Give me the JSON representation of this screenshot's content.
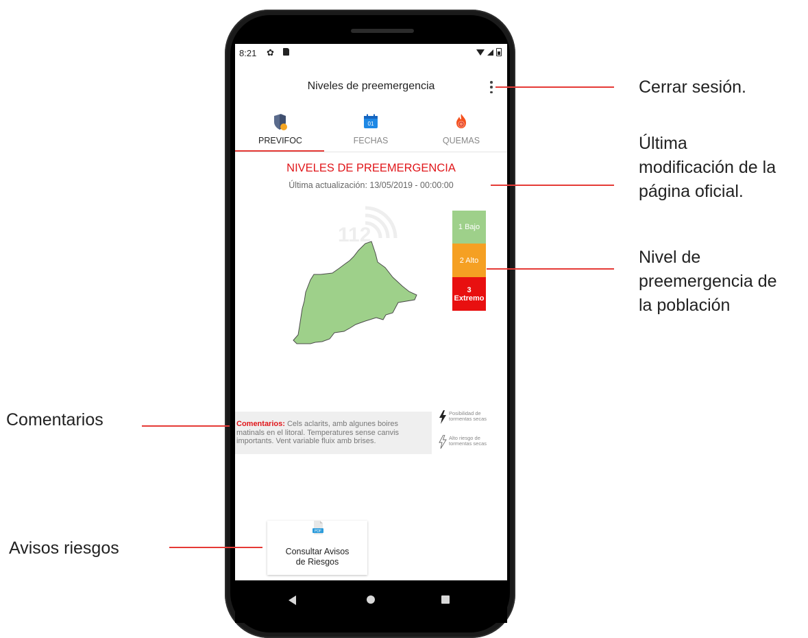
{
  "status_bar": {
    "time": "8:21",
    "gear_glyph": "✿"
  },
  "app_bar": {
    "title": "Niveles de preemergencia"
  },
  "tabs": [
    {
      "label": "PREVIFOC",
      "icon": "shield-icon",
      "color": "#222222"
    },
    {
      "label": "FECHAS",
      "icon": "calendar-icon",
      "calendar_day": "01",
      "color": "#888888"
    },
    {
      "label": "QUEMAS",
      "icon": "fire-icon",
      "color": "#888888"
    }
  ],
  "content": {
    "title": "NIVELES DE PREEMERGENCIA",
    "last_update": "Última actualización: 13/05/2019 - 00:00:00",
    "watermark": "112",
    "levels": [
      {
        "label": "1 Bajo",
        "color": "#9ed08a"
      },
      {
        "label": "2 Alto",
        "color": "#f5a023"
      },
      {
        "label": "3 Extremo",
        "num": "3",
        "name": "Extremo",
        "color": "#e81010"
      }
    ],
    "comments_label": "Comentarios:",
    "comments_text": " Cels aclarits, amb algunes boires matinals en el litoral. Temperatures sense canvis importants. Vent variable fluix amb brises.",
    "legend": [
      {
        "icon": "lightning-filled-icon",
        "text": "Posibilidad de tormentas secas"
      },
      {
        "icon": "lightning-outline-icon",
        "text": "Alto riesgo de tormentas secas"
      }
    ],
    "risk_button": {
      "line1": "Consultar Avisos",
      "line2": "de Riesgos",
      "icon_text": "PDF"
    }
  },
  "annotations": {
    "cerrar": "Cerrar sesión.",
    "ultima_1": "Última",
    "ultima_2": "modificación de la",
    "ultima_3": "página oficial.",
    "nivel_1": "Nivel de",
    "nivel_2": "preemergencia de",
    "nivel_3": "la población",
    "comentarios": "Comentarios",
    "avisos": "Avisos riesgos"
  },
  "colors": {
    "accent": "#e53935",
    "title_red": "#e0161a",
    "map_green": "#9ed08a"
  }
}
